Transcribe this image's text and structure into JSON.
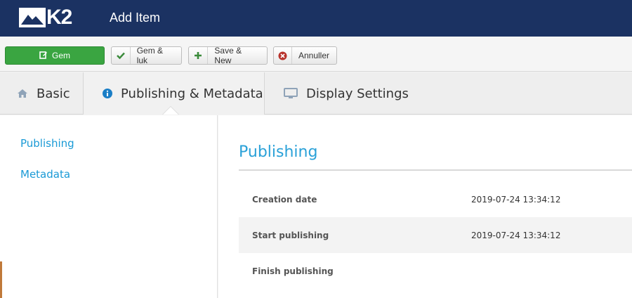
{
  "header": {
    "logo_text": "K2",
    "title": "Add Item"
  },
  "toolbar": {
    "save_label": "Gem",
    "save_close_label": "Gem & luk",
    "save_new_label": "Save & New",
    "cancel_label": "Annuller"
  },
  "tabs": [
    {
      "label": "Basic",
      "icon": "home-icon"
    },
    {
      "label": "Publishing & Metadata",
      "icon": "info-icon",
      "active": true
    },
    {
      "label": "Display Settings",
      "icon": "monitor-icon"
    }
  ],
  "sidebar": {
    "items": [
      {
        "label": "Publishing"
      },
      {
        "label": "Metadata"
      }
    ]
  },
  "main": {
    "title": "Publishing",
    "rows": [
      {
        "label": "Creation date",
        "value": "2019-07-24 13:34:12"
      },
      {
        "label": "Start publishing",
        "value": "2019-07-24 13:34:12"
      },
      {
        "label": "Finish publishing",
        "value": ""
      }
    ]
  },
  "colors": {
    "header_bg": "#1b3262",
    "save_green": "#3aa541",
    "link_blue": "#1a9ad6",
    "accent_blue": "#2aa1d8"
  }
}
